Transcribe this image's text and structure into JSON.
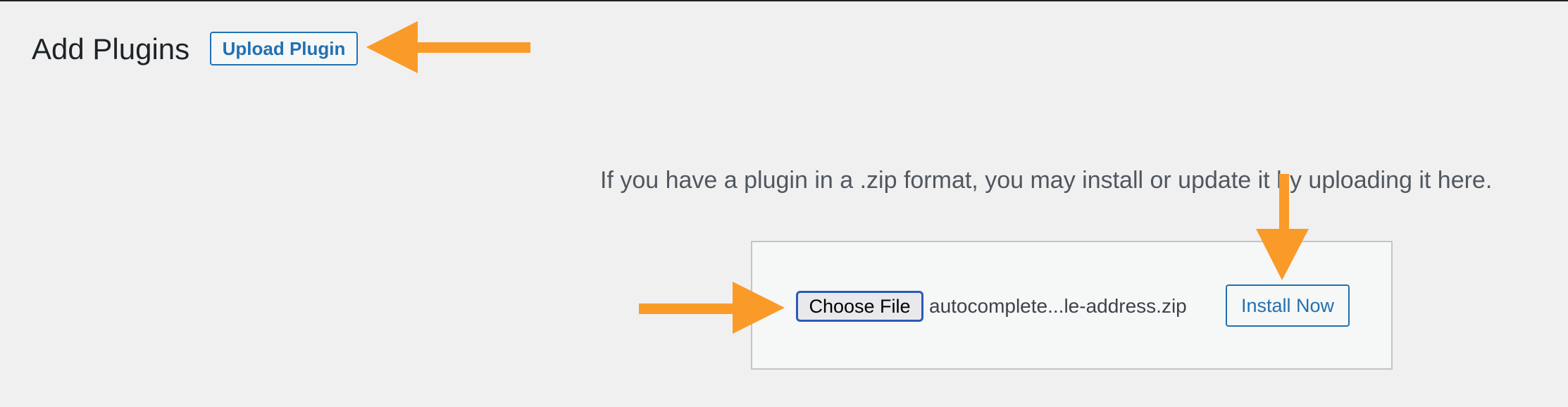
{
  "header": {
    "title": "Add Plugins",
    "upload_button_label": "Upload Plugin"
  },
  "upload_section": {
    "help_text": "If you have a plugin in a .zip format, you may install or update it by uploading it here.",
    "choose_file_label": "Choose File",
    "selected_file_name": "autocomplete...le-address.zip",
    "install_button_label": "Install Now"
  },
  "annotations": {
    "arrow_color": "#fa9a28",
    "arrows": [
      "arrow-to-upload-plugin",
      "arrow-to-install-now",
      "arrow-to-choose-file"
    ]
  },
  "colors": {
    "background": "#f0f0f1",
    "accent": "#2271b1",
    "focus_border": "#2b5bb5"
  }
}
